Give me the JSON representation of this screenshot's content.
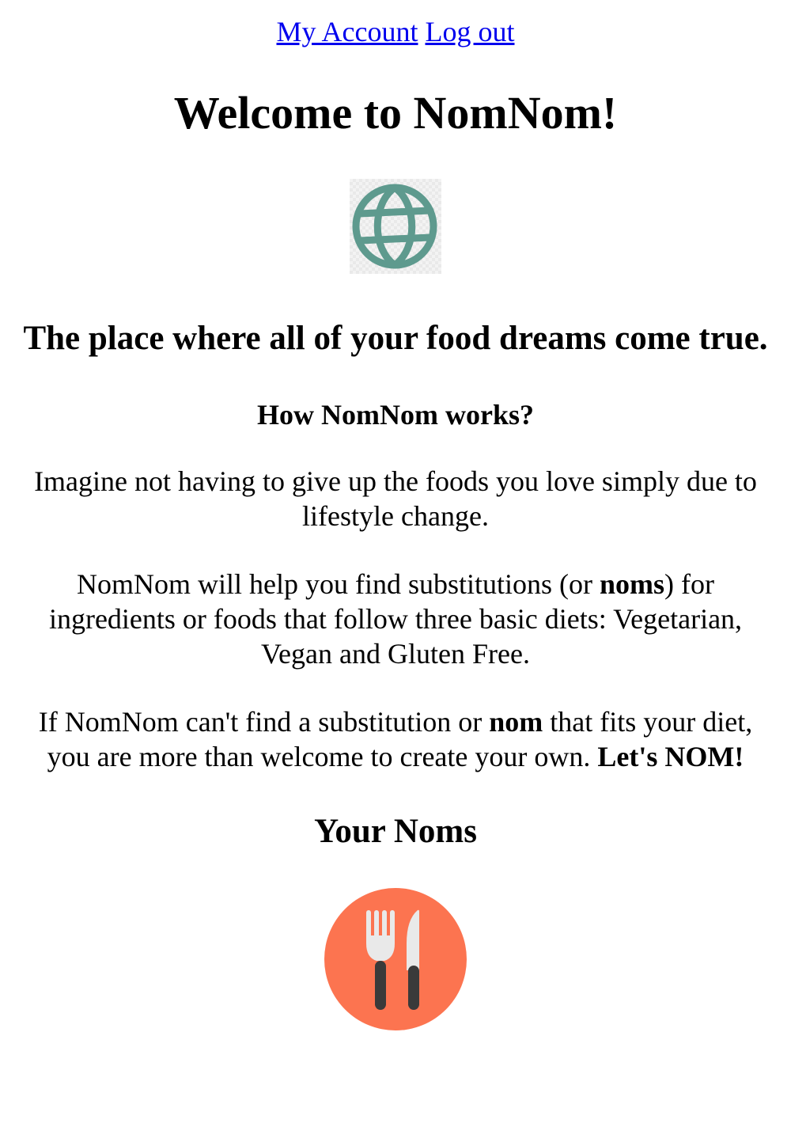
{
  "nav": {
    "my_account": "My Account",
    "log_out": "Log out"
  },
  "header": {
    "title": "Welcome to NomNom!"
  },
  "tagline": "The place where all of your food dreams come true.",
  "how_heading": "How NomNom works?",
  "paragraphs": {
    "p1": "Imagine not having to give up the foods you love simply due to lifestyle change.",
    "p2_before": "NomNom will help you find substitutions (or ",
    "p2_bold": "noms",
    "p2_after": ") for ingredients or foods that follow three basic diets: Vegetarian, Vegan and Gluten Free.",
    "p3_before": "If NomNom can't find a substitution or ",
    "p3_bold": "nom",
    "p3_middle": " that fits your diet, you are more than welcome to create your own. ",
    "p3_bold_end": "Let's NOM!"
  },
  "noms_heading": "Your Noms",
  "icons": {
    "logo": "globe-icon",
    "noms": "fork-knife-icon"
  },
  "colors": {
    "link": "#0000ee",
    "globe": "#5e9a8e",
    "plate": "#fc7450",
    "utensil_light": "#e9e9e9",
    "utensil_dark": "#3a3a3a"
  }
}
